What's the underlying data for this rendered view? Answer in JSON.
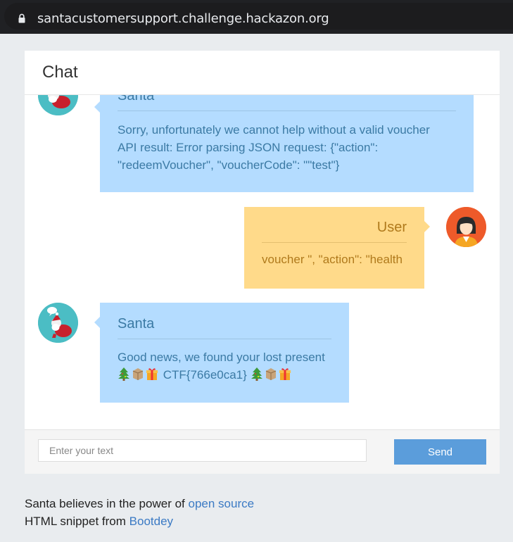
{
  "browser": {
    "url": "santacustomersupport.challenge.hackazon.org"
  },
  "chat": {
    "title": "Chat",
    "messages": [
      {
        "sender": "Santa",
        "lines": [
          "Sorry, unfortunately we cannot help without a valid voucher",
          "API result: Error parsing JSON request: {\"action\":",
          "\"redeemVoucher\", \"voucherCode\": \"\"test\"}"
        ]
      },
      {
        "sender": "User",
        "lines": [
          "voucher \", \"action\": \"health"
        ]
      },
      {
        "sender": "Santa",
        "lines": [
          "Good news, we found your lost present"
        ],
        "flag": "CTF{766e0ca1}"
      }
    ],
    "input_placeholder": "Enter your text",
    "send_label": "Send"
  },
  "credits": {
    "line1_text": "Santa believes in the power of",
    "line1_link": "open source",
    "line2_text": "HTML snippet from",
    "line2_link": "Bootdey"
  },
  "icons": {
    "lock": "lock-icon",
    "santa_avatar": "santa-avatar",
    "user_avatar": "user-avatar",
    "tree": "christmas-tree-emoji",
    "package": "package-emoji",
    "gift": "gift-emoji"
  },
  "colors": {
    "santa_bubble": "#b4dcff",
    "user_bubble": "#ffda8a",
    "send_button": "#5b9ddb",
    "link": "#3b7ac4"
  }
}
